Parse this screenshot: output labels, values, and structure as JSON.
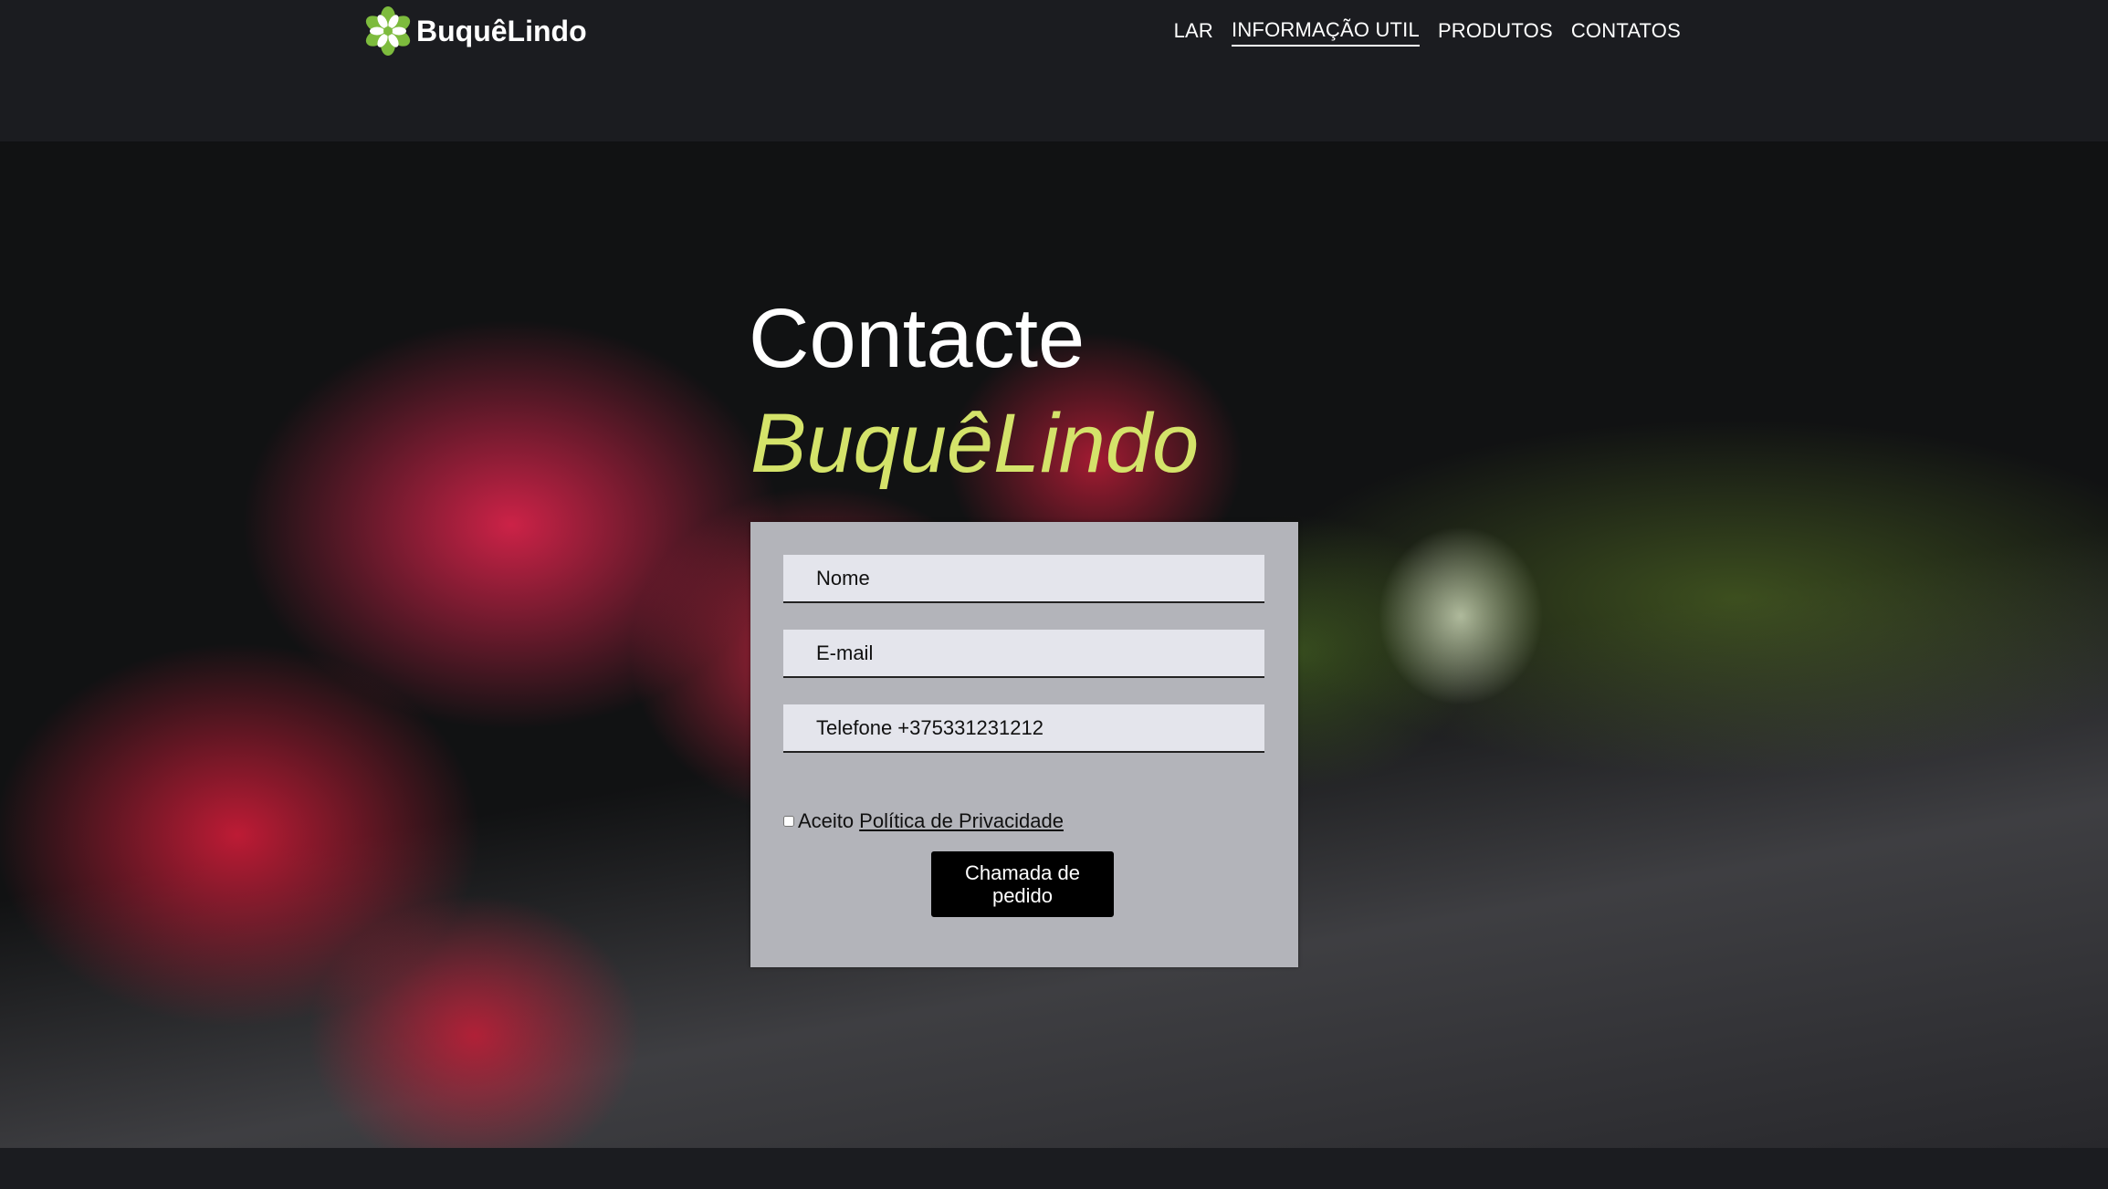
{
  "brand": {
    "name": "BuquêLindo",
    "logo_icon": "flower-logo-icon",
    "accent_color": "#d4e36a"
  },
  "nav": {
    "items": [
      {
        "label": "LAR",
        "active": false
      },
      {
        "label": "INFORMAÇÃO UTIL",
        "active": true
      },
      {
        "label": "PRODUTOS",
        "active": false
      },
      {
        "label": "CONTATOS",
        "active": false
      }
    ]
  },
  "hero": {
    "title": "Contacte",
    "brand": "BuquêLindo"
  },
  "form": {
    "name_placeholder": "Nome",
    "email_placeholder": "E-mail",
    "phone_placeholder": "Telefone +375331231212",
    "consent_text": "Aceito",
    "consent_link": "Política de Privacidade",
    "consent_checked": false,
    "submit_label": "Chamada de pedido"
  }
}
